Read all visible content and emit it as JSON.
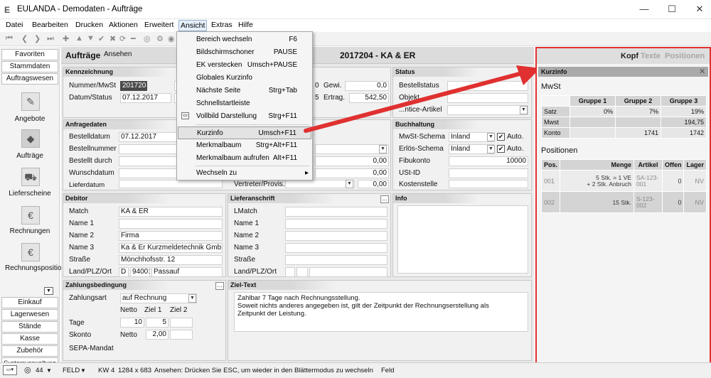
{
  "window": {
    "logo": "E",
    "title": "EULANDA - Demodaten - Aufträge",
    "minimize": "—",
    "maximize": "☐",
    "close": "✕"
  },
  "menubar": [
    "Datei",
    "Bearbeiten",
    "Drucken",
    "Aktionen",
    "Erweitert",
    "Ansicht",
    "Extras",
    "Hilfe"
  ],
  "sidebar": {
    "top_buttons": [
      "Favoriten",
      "Stammdaten",
      "Auftragswesen"
    ],
    "modules": [
      "Angebote",
      "Aufträge",
      "Lieferscheine",
      "Rechnungen",
      "Rechnungspositionen"
    ],
    "bottom_buttons": [
      "Einkauf",
      "Lagerwesen",
      "Stände",
      "Kasse",
      "Zubehör",
      "Systemverwaltung"
    ]
  },
  "main": {
    "title": "Aufträge",
    "subtitle": "Ansehen",
    "record": "2017204 - KA & ER",
    "kennzeichnung": {
      "head": "Kennzeichnung",
      "nr_label": "Nummer/MwSt",
      "nr": "2017204",
      "date_label": "Datum/Status",
      "date": "07.12.2017",
      "gewi_label": "Gewi.",
      "gewi": "0,0",
      "ertrag_label": "Ertrag.",
      "ertrag": "542,50",
      "frag1": "0",
      "frag2": "5"
    },
    "status": {
      "head": "Status",
      "bestellstatus": "Bestellstatus",
      "objekt": "Objekt",
      "artikel": "...ntice-Artikel"
    },
    "anfragedaten": {
      "head": "Anfragedaten",
      "bestelldatum_label": "Bestelldatum",
      "bestelldatum": "07.12.2017",
      "bestellnummer": "Bestellnummer",
      "bestellt_durch": "Bestellt durch",
      "wunschdatum": "Wunschdatum",
      "lieferdatum": "Lieferdatum",
      "v1": "0,00",
      "v2": "0,00",
      "vertreter": "Vertreter/Provis.",
      "v3": "0,00"
    },
    "buchhaltung": {
      "head": "Buchhaltung",
      "mwst_schema": "MwSt-Schema",
      "mwst_val": "Inland",
      "erloes_schema": "Erlös-Schema",
      "erloes_val": "Inland",
      "auto": "Auto.",
      "fibukonto": "Fibukonto",
      "fibu_val": "10000",
      "ustid": "USt-ID",
      "kostenstelle": "Kostenstelle"
    },
    "debitor": {
      "head": "Debitor",
      "match": "Match",
      "match_val": "KA & ER",
      "name1": "Name 1",
      "name2": "Name 2",
      "name2_val": "Firma",
      "name3": "Name 3",
      "name3_val": "Ka & Er Kurzmeldetechnik GmbH",
      "strasse": "Straße",
      "strasse_val": "Mönchhofsstr. 12",
      "land": "Land/PLZ/Ort",
      "land_val": "D",
      "plz_val": "94001",
      "ort_val": "Passauf"
    },
    "lieferanschrift": {
      "head": "Lieferanschrift",
      "lmatch": "LMatch",
      "name1": "Name 1",
      "name2": "Name 2",
      "name3": "Name 3",
      "strasse": "Straße",
      "land": "Land/PLZ/Ort"
    },
    "info": {
      "head": "Info"
    },
    "zahlung": {
      "head": "Zahlungsbedingung",
      "zahlungsart": "Zahlungsart",
      "zahlungsart_val": "auf Rechnung",
      "netto": "Netto",
      "ziel1": "Ziel 1",
      "ziel2": "Ziel 2",
      "tage": "Tage",
      "tage_netto": "10",
      "tage_z1": "5",
      "skonto": "Skonto",
      "skonto_netto": "Netto",
      "skonto_val": "2,00",
      "sepa": "SEPA-Mandat"
    },
    "zieltext": {
      "head": "Ziel-Text",
      "line1": "Zahlbar 7 Tage nach Rechnungsstellung.",
      "line2": "Soweit nichts anderes angegeben ist, gilt der Zeitpunkt der Rechnungserstellung als",
      "line3": "Zeitpunkt der Leistung."
    }
  },
  "ansicht_menu": [
    {
      "label": "Bereich wechseln",
      "key": "F6"
    },
    {
      "label": "Bildschirmschoner",
      "key": "PAUSE"
    },
    {
      "label": "EK verstecken",
      "key": "Umsch+PAUSE"
    },
    {
      "label": "Globales Kurzinfo",
      "key": ""
    },
    {
      "label": "Nächste Seite",
      "key": "Strg+Tab"
    },
    {
      "label": "Schnellstartleiste",
      "key": ""
    },
    {
      "label": "Vollbild Darstellung",
      "key": "Strg+F11"
    },
    {
      "label": "Kurzinfo",
      "key": "Umsch+F11"
    },
    {
      "label": "Merkmalbaum",
      "key": "Strg+Alt+F11"
    },
    {
      "label": "Merkmalbaum aufrufen",
      "key": "Alt+F11"
    },
    {
      "label": "Wechseln zu",
      "key": "▸"
    }
  ],
  "right_panel": {
    "tabs": [
      "Kopf",
      "Texte",
      "Positionen"
    ],
    "kurzinfo": "Kurzinfo",
    "close": "✕",
    "mwst": {
      "title": "MwSt",
      "headers": [
        "Gruppe 1",
        "Gruppe 2",
        "Gruppe 3"
      ],
      "rows": [
        {
          "label": "Satz",
          "values": [
            "0%",
            "7%",
            "19%"
          ]
        },
        {
          "label": "Mwst",
          "values": [
            "",
            "",
            "194,75"
          ]
        },
        {
          "label": "Konto",
          "values": [
            "",
            "1741",
            "1742"
          ]
        }
      ]
    },
    "positionen": {
      "title": "Positionen",
      "headers": [
        "Pos.",
        "Menge",
        "Artikel",
        "Offen",
        "Lager"
      ],
      "rows": [
        {
          "pos": "001",
          "menge1": "5 Stk. = 1 VE",
          "menge2": "+ 2 Stk. Anbruch",
          "artikel1": "SA-123-",
          "artikel2": "001",
          "offen": "0",
          "lager": "NV"
        },
        {
          "pos": "002",
          "menge1": "15 Stk.",
          "menge2": "",
          "artikel1": "S-123-",
          "artikel2": "002",
          "offen": "0",
          "lager": "NV"
        }
      ]
    }
  },
  "statusbar": {
    "zoom": "44",
    "feld": "FELD",
    "kw": "KW 4",
    "resolution": "1284 x 683",
    "message": "Ansehen: Drücken Sie ESC, um wieder in den Blättermodus zu wechseln",
    "feld2": "Feld"
  },
  "colors": {
    "accent_red": "#e03030",
    "highlight": "#e3e3e3"
  }
}
